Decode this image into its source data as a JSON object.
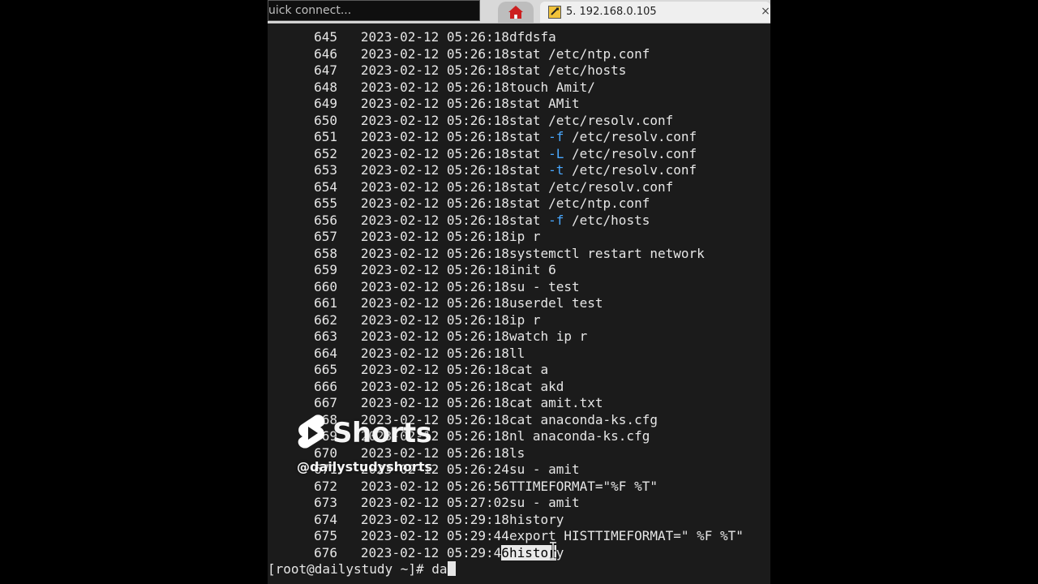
{
  "window": {
    "quick_connect_text": "uick connect...",
    "session_tab_title": "5. 192.168.0.105",
    "close_glyph": "×"
  },
  "icons": {
    "home": "home-icon",
    "session": "ssh-session-icon",
    "cursor": "i-beam-cursor-icon"
  },
  "colors": {
    "terminal_bg": "#1b1b1b",
    "terminal_fg": "#e6e6e6",
    "option_blue": "#49a8ff",
    "home_red": "#cc1f1f"
  },
  "history": [
    {
      "num": "645",
      "ts": "2023-02-12 05:26:18",
      "cmd": "dfdsfa"
    },
    {
      "num": "646",
      "ts": "2023-02-12 05:26:18",
      "cmd": "stat /etc/ntp.conf"
    },
    {
      "num": "647",
      "ts": "2023-02-12 05:26:18",
      "cmd": "stat /etc/hosts"
    },
    {
      "num": "648",
      "ts": "2023-02-12 05:26:18",
      "cmd": "touch Amit/"
    },
    {
      "num": "649",
      "ts": "2023-02-12 05:26:18",
      "cmd": "stat AMit"
    },
    {
      "num": "650",
      "ts": "2023-02-12 05:26:18",
      "cmd": "stat /etc/resolv.conf"
    },
    {
      "num": "651",
      "ts": "2023-02-12 05:26:18",
      "cmd_pre": "stat ",
      "opt": "-f",
      "cmd_post": " /etc/resolv.conf"
    },
    {
      "num": "652",
      "ts": "2023-02-12 05:26:18",
      "cmd_pre": "stat ",
      "opt": "-L",
      "cmd_post": " /etc/resolv.conf"
    },
    {
      "num": "653",
      "ts": "2023-02-12 05:26:18",
      "cmd_pre": "stat ",
      "opt": "-t",
      "cmd_post": " /etc/resolv.conf"
    },
    {
      "num": "654",
      "ts": "2023-02-12 05:26:18",
      "cmd": "stat /etc/resolv.conf"
    },
    {
      "num": "655",
      "ts": "2023-02-12 05:26:18",
      "cmd": "stat /etc/ntp.conf"
    },
    {
      "num": "656",
      "ts": "2023-02-12 05:26:18",
      "cmd_pre": "stat ",
      "opt": "-f",
      "cmd_post": " /etc/hosts"
    },
    {
      "num": "657",
      "ts": "2023-02-12 05:26:18",
      "cmd": "ip r"
    },
    {
      "num": "658",
      "ts": "2023-02-12 05:26:18",
      "cmd": "systemctl restart network"
    },
    {
      "num": "659",
      "ts": "2023-02-12 05:26:18",
      "cmd": "init 6"
    },
    {
      "num": "660",
      "ts": "2023-02-12 05:26:18",
      "cmd": "su - test"
    },
    {
      "num": "661",
      "ts": "2023-02-12 05:26:18",
      "cmd": "userdel test"
    },
    {
      "num": "662",
      "ts": "2023-02-12 05:26:18",
      "cmd": "ip r"
    },
    {
      "num": "663",
      "ts": "2023-02-12 05:26:18",
      "cmd": "watch ip r"
    },
    {
      "num": "664",
      "ts": "2023-02-12 05:26:18",
      "cmd": "ll"
    },
    {
      "num": "665",
      "ts": "2023-02-12 05:26:18",
      "cmd": "cat a"
    },
    {
      "num": "666",
      "ts": "2023-02-12 05:26:18",
      "cmd": "cat akd"
    },
    {
      "num": "667",
      "ts": "2023-02-12 05:26:18",
      "cmd": "cat amit.txt"
    },
    {
      "num": "668",
      "ts": "2023-02-12 05:26:18",
      "cmd": "cat anaconda-ks.cfg"
    },
    {
      "num": "669",
      "ts": "2023-02-12 05:26:18",
      "cmd": "nl anaconda-ks.cfg"
    },
    {
      "num": "670",
      "ts": "2023-02-12 05:26:18",
      "cmd": "ls"
    },
    {
      "num": "671",
      "ts": "2023-02-12 05:26:24",
      "cmd": "su - amit"
    },
    {
      "num": "672",
      "ts": "2023-02-12 05:26:56",
      "cmd": "TTIMEFORMAT=\"%F %T\""
    },
    {
      "num": "673",
      "ts": "2023-02-12 05:27:02",
      "cmd": "su - amit"
    },
    {
      "num": "674",
      "ts": "2023-02-12 05:29:18",
      "cmd": "history"
    },
    {
      "num": "675",
      "ts": "2023-02-12 05:29:44",
      "cmd": "export HISTTIMEFORMAT=\" %F %T\""
    },
    {
      "num": "676",
      "ts_pre": "2023-02-12 05:29:4",
      "ts_sel": "6",
      "cmd_sel": "histor",
      "cmd_post": "y"
    }
  ],
  "prompt": {
    "text": "[root@dailystudy ~]# ",
    "input": "da"
  },
  "watermark": {
    "brand": "Shorts",
    "handle": "@dailystudyshorts"
  }
}
